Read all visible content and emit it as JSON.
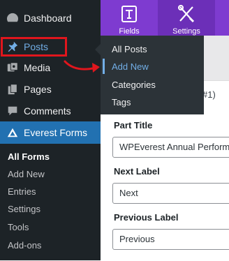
{
  "sidebar": {
    "items": [
      {
        "label": "Dashboard",
        "icon": "dashboard-icon"
      },
      {
        "label": "Posts",
        "icon": "pushpin-icon"
      },
      {
        "label": "Media",
        "icon": "media-icon"
      },
      {
        "label": "Pages",
        "icon": "pages-icon"
      },
      {
        "label": "Comments",
        "icon": "comments-icon"
      },
      {
        "label": "Everest Forms",
        "icon": "everest-forms-icon"
      }
    ],
    "submenu": [
      "All Forms",
      "Add New",
      "Entries",
      "Settings",
      "Tools",
      "Add-ons"
    ]
  },
  "flyout": {
    "items": [
      "All Posts",
      "Add New",
      "Categories",
      "Tags"
    ]
  },
  "toolbar": {
    "fields_label": "Fields",
    "settings_label": "Settings"
  },
  "panel": {
    "heading_fragment": "#1)",
    "part_title_label": "Part Title",
    "part_title_value": "WPEverest Annual Performance Review",
    "next_label_label": "Next Label",
    "next_label_value": "Next",
    "previous_label_label": "Previous Label",
    "previous_label_value": "Previous"
  },
  "colors": {
    "sidebar_bg": "#1d2327",
    "active_bg": "#2271b1",
    "toolbar_purple": "#7e3bd0",
    "callout_red": "#e0161d"
  }
}
